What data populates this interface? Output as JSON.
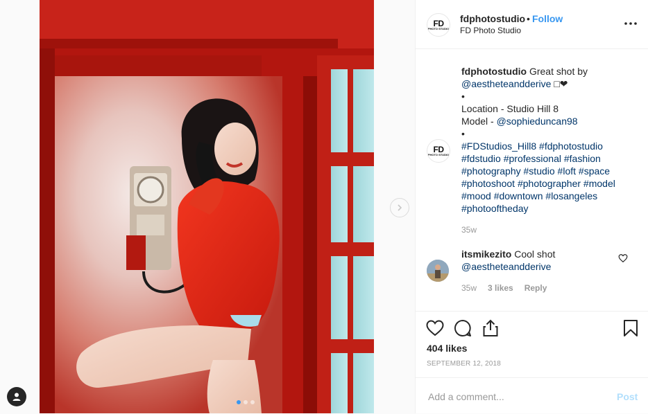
{
  "post": {
    "image_alt": "Model in red sweater holding a payphone receiver inside a red phone booth",
    "carousel_total": 3,
    "carousel_active": 1
  },
  "header": {
    "avatar_text": "FD",
    "avatar_subtext": "PHOTO STUDIO",
    "username": "fdphotostudio",
    "separator": "•",
    "follow_label": "Follow",
    "full_name": "FD Photo Studio"
  },
  "caption": {
    "username": "fdphotostudio",
    "text_intro": "Great shot by",
    "mention": "@aestheteandderive",
    "emoji": "□❤",
    "bullet": "•",
    "location_line": "Location - Studio Hill 8",
    "model_prefix": "Model - ",
    "model_mention": "@sophieduncan98",
    "hashtags": "#FDStudios_Hill8 #fdphotostudio #fdstudio #professional #fashion #photography #studio #loft #space #photoshoot #photographer #model #mood #downtown #losangeles #photooftheday",
    "time": "35w"
  },
  "comment": {
    "username": "itsmikezito",
    "text": "Cool shot",
    "mention": "@aestheteandderive",
    "time": "35w",
    "likes": "3 likes",
    "reply_label": "Reply"
  },
  "footer": {
    "likes": "404 likes",
    "date": "SEPTEMBER 12, 2018",
    "comment_placeholder": "Add a comment...",
    "post_label": "Post"
  },
  "colors": {
    "accent": "#3897f0",
    "link": "#003569",
    "muted": "#999999",
    "post_disabled": "#b2dffc"
  }
}
